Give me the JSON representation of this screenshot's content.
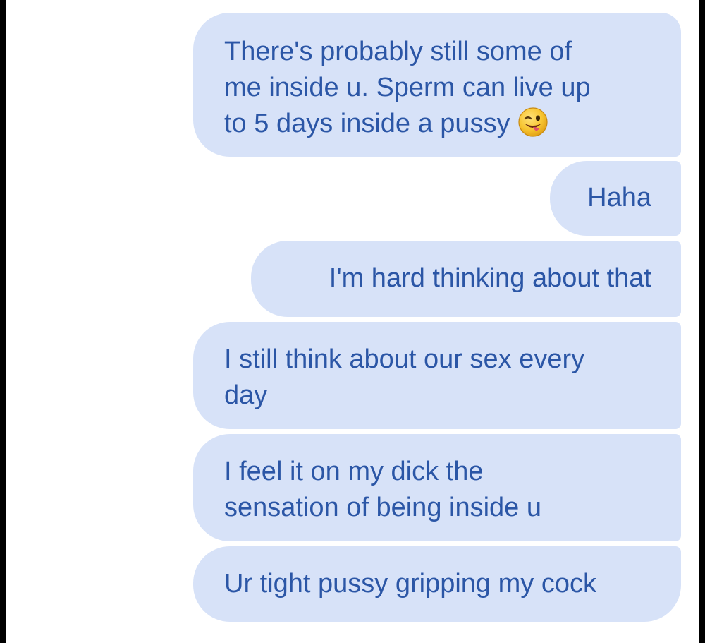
{
  "conversation": {
    "messages": [
      {
        "text_before_emoji": "There's probably still some of\nme inside u. Sperm can live up\nto 5 days inside a pussy",
        "emoji": "winking-face-with-tongue-icon",
        "sender": "self"
      },
      {
        "text": "Haha",
        "sender": "self"
      },
      {
        "text": "I'm hard thinking about that",
        "sender": "self"
      },
      {
        "text": "I still think about our sex every\nday",
        "sender": "self"
      },
      {
        "text": "I feel it on my dick the\nsensation of being inside u",
        "sender": "self"
      },
      {
        "text": "Ur tight pussy gripping my cock",
        "sender": "self"
      }
    ]
  },
  "colors": {
    "bubble_background": "#d7e2f8",
    "bubble_text": "#2b56a6",
    "screen_background": "#ffffff",
    "frame": "#000000"
  }
}
